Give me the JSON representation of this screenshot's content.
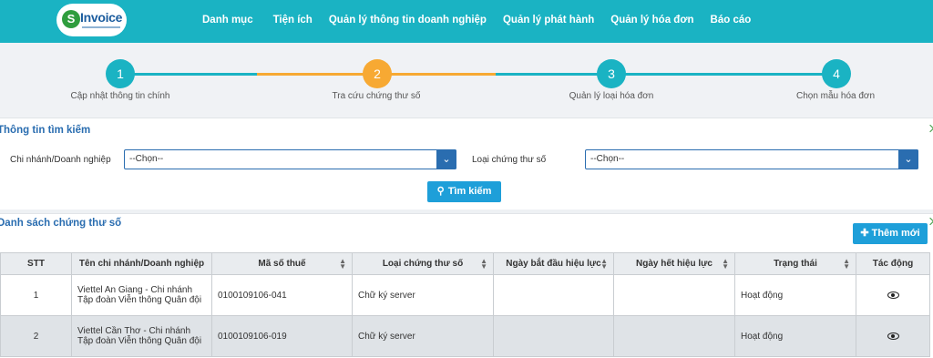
{
  "logo": {
    "letter": "S",
    "text": "Invoice"
  },
  "nav": [
    "Danh mục",
    "Tiện ích",
    "Quản lý thông tin doanh nghiệp",
    "Quản lý phát hành",
    "Quản lý hóa đơn",
    "Báo cáo"
  ],
  "steps": [
    {
      "num": "1",
      "label": "Cập nhật thông tin chính",
      "state": "done"
    },
    {
      "num": "2",
      "label": "Tra cứu chứng thư số",
      "state": "active"
    },
    {
      "num": "3",
      "label": "Quản lý loại hóa đơn",
      "state": "todo"
    },
    {
      "num": "4",
      "label": "Chọn mẫu hóa đơn",
      "state": "todo"
    }
  ],
  "search": {
    "title": "Thông tin tìm kiếm",
    "branch_label": "Chi nhánh/Doanh nghiệp",
    "branch_value": "--Chọn--",
    "cert_type_label": "Loại chứng thư số",
    "cert_type_value": "--Chọn--",
    "button": "Tìm kiếm"
  },
  "list": {
    "title": "Danh sách chứng thư số",
    "add_button": "Thêm mới",
    "columns": [
      "STT",
      "Tên chi nhánh/Doanh nghiệp",
      "Mã số thuế",
      "Loại chứng thư số",
      "Ngày bắt đầu hiệu lực",
      "Ngày hết hiệu lực",
      "Trạng thái",
      "Tác động"
    ],
    "rows": [
      [
        "1",
        "Viettel An Giang - Chi nhánh Tập đoàn Viễn thông Quân đội",
        "0100109106-041",
        "Chữ ký server",
        "",
        "",
        "Hoạt động"
      ],
      [
        "2",
        "Viettel Cần Thơ - Chi nhánh Tập đoàn Viễn thông Quân đội",
        "0100109106-019",
        "Chữ ký server",
        "",
        "",
        "Hoạt động"
      ]
    ]
  },
  "colors": {
    "header": "#1ab3c3",
    "step_active": "#f7a933",
    "accent_blue": "#1e9fd9",
    "title_blue": "#2a6db0"
  },
  "icons": {
    "search": "search-icon",
    "add": "plus-icon",
    "view": "eye-icon",
    "dropdown": "chevron-down-icon"
  }
}
